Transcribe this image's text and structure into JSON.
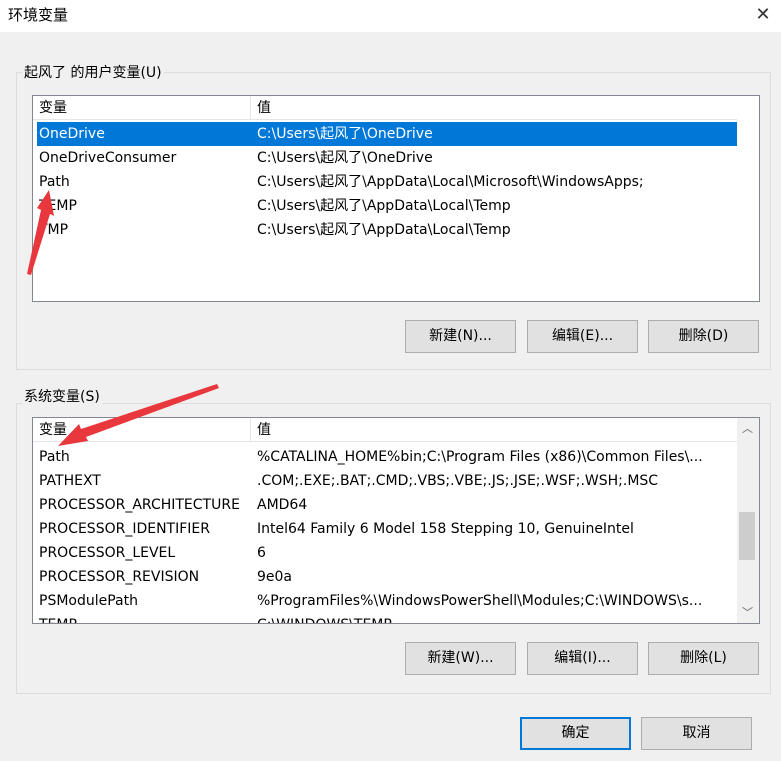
{
  "window": {
    "title": "环境变量",
    "close_glyph": "✕"
  },
  "user_vars": {
    "group_title": "起风了 的用户变量(U)",
    "columns": [
      "变量",
      "值"
    ],
    "rows": [
      {
        "name": "OneDrive",
        "value": "C:\\Users\\起风了\\OneDrive",
        "selected": true
      },
      {
        "name": "OneDriveConsumer",
        "value": "C:\\Users\\起风了\\OneDrive",
        "selected": false
      },
      {
        "name": "Path",
        "value": "C:\\Users\\起风了\\AppData\\Local\\Microsoft\\WindowsApps;",
        "selected": false
      },
      {
        "name": "TEMP",
        "value": "C:\\Users\\起风了\\AppData\\Local\\Temp",
        "selected": false
      },
      {
        "name": "TMP",
        "value": "C:\\Users\\起风了\\AppData\\Local\\Temp",
        "selected": false
      }
    ],
    "buttons": {
      "new_label": "新建(N)...",
      "edit_label": "编辑(E)...",
      "delete_label": "删除(D)"
    }
  },
  "system_vars": {
    "group_title": "系统变量(S)",
    "columns": [
      "变量",
      "值"
    ],
    "rows": [
      {
        "name": "Path",
        "value": "%CATALINA_HOME%bin;C:\\Program Files (x86)\\Common Files\\..."
      },
      {
        "name": "PATHEXT",
        "value": ".COM;.EXE;.BAT;.CMD;.VBS;.VBE;.JS;.JSE;.WSF;.WSH;.MSC"
      },
      {
        "name": "PROCESSOR_ARCHITECTURE",
        "value": "AMD64"
      },
      {
        "name": "PROCESSOR_IDENTIFIER",
        "value": "Intel64 Family 6 Model 158 Stepping 10, GenuineIntel"
      },
      {
        "name": "PROCESSOR_LEVEL",
        "value": "6"
      },
      {
        "name": "PROCESSOR_REVISION",
        "value": "9e0a"
      },
      {
        "name": "PSModulePath",
        "value": "%ProgramFiles%\\WindowsPowerShell\\Modules;C:\\WINDOWS\\s..."
      },
      {
        "name": "TEMP",
        "value": "C:\\WINDOWS\\TEMP"
      }
    ],
    "buttons": {
      "new_label": "新建(W)...",
      "edit_label": "编辑(I)...",
      "delete_label": "删除(L)"
    },
    "scrollbar": {
      "up_glyph": "︿",
      "down_glyph": "﹀"
    }
  },
  "footer": {
    "ok_label": "确定",
    "cancel_label": "取消"
  },
  "colors": {
    "selection": "#0078d7",
    "annotation_arrow": "#e8383d"
  }
}
